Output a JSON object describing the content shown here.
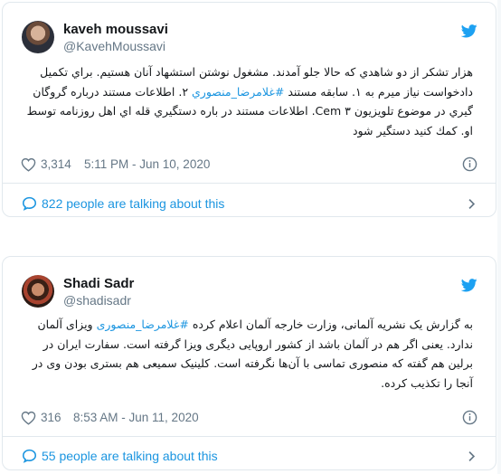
{
  "colors": {
    "link": "#1b95e0",
    "muted": "#657786",
    "text": "#14171a",
    "border": "#e1e8ed",
    "twitter": "#1da1f2"
  },
  "tweets": [
    {
      "display_name": "kaveh moussavi",
      "handle": "@KavehMoussavi",
      "text_parts": [
        "هزار تشکر از دو شاهدي كه حالا جلو آمدند. مشغول نوشتن استشهاد آنان هستيم. براي تكميل دادخواست نياز ميرم به ۱. سابقه مستند ",
        "#غلامرضا_منصوري",
        " ۲. اطلاعات مستند درباره گروگان گيري در موضوع تلويزيون Cem ۳. اطلاعات مستند در باره دستگيري قله اي اهل روزنامه توسط او. كمك كنيد دستگير شود"
      ],
      "likes": "3,314",
      "timestamp": "5:11 PM - Jun 10, 2020",
      "talking": "822 people are talking about this",
      "icons": {
        "twitter": "twitter-bird-icon",
        "like": "heart-icon",
        "info": "info-icon",
        "talk": "speech-bubble-icon",
        "more": "chevron-right-icon"
      }
    },
    {
      "display_name": "Shadi Sadr",
      "handle": "@shadisadr",
      "text_parts": [
        "به گزارش یک نشریه آلمانی، وزارت خارجه آلمان اعلام کرده ",
        "#غلامرضا_منصوری",
        " ویزای آلمان ندارد. یعنی اگر هم در آلمان باشد از کشور اروپایی دیگری ویزا گرفته است. سفارت ایران در برلین هم گفته که منصوری تماسی با آن‌ها نگرفته است. کلینیک سمیعی هم بستری بودن وی در آنجا را تکذیب کرده."
      ],
      "likes": "316",
      "timestamp": "8:53 AM - Jun 11, 2020",
      "talking": "55 people are talking about this",
      "icons": {
        "twitter": "twitter-bird-icon",
        "like": "heart-icon",
        "info": "info-icon",
        "talk": "speech-bubble-icon",
        "more": "chevron-right-icon"
      }
    }
  ]
}
